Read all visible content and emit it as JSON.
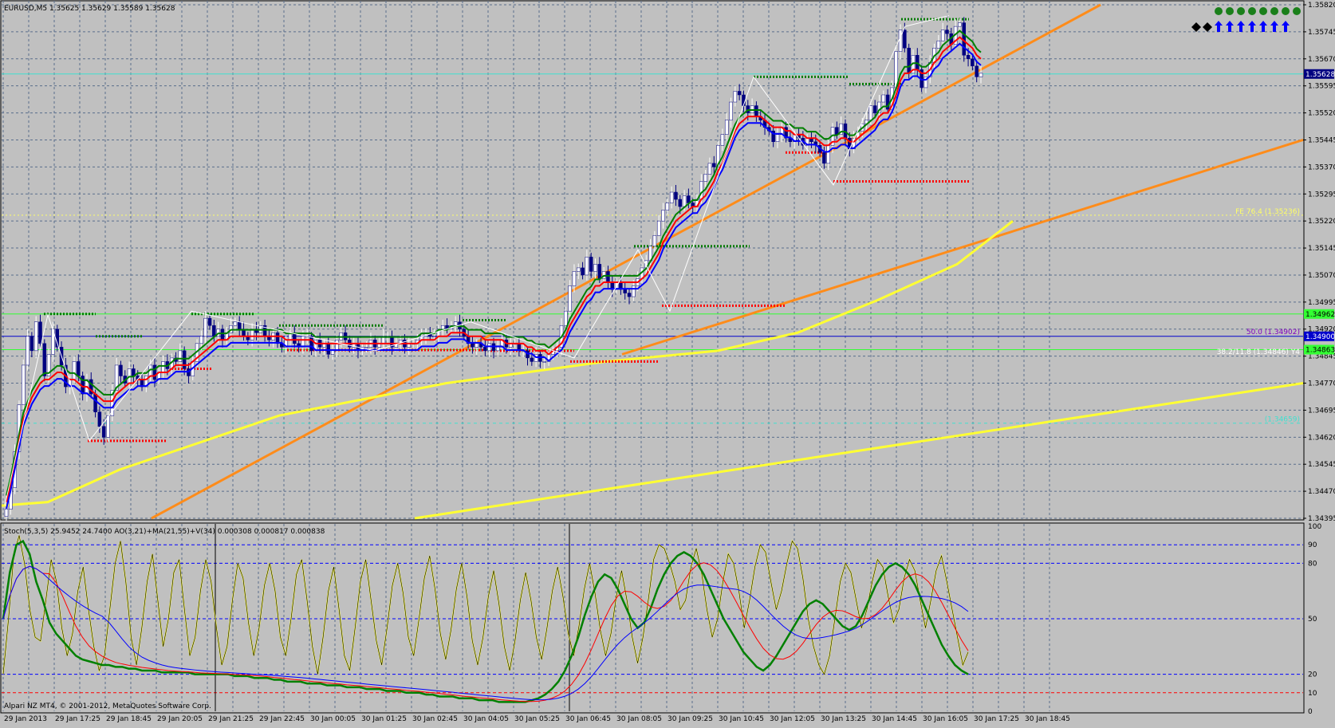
{
  "window": {
    "symbol_header": "EURUSD,M5  1.35625 1.35629 1.35589 1.35628",
    "indicator_header": "Stoch(5,3,5) 25.9452 24.7400  AO(3,21)+MA(21,55)+V(34) 0.000308 0.000817 0.000838",
    "copyright": "Alpari NZ MT4, © 2001-2012, MetaQuotes Software Corp."
  },
  "colors": {
    "background": "#c0c0c0",
    "grid": "#5a6e8c",
    "bull_candle": "#ffffff",
    "bear_candle": "#000080",
    "ma_green": "#008000",
    "ma_red": "#ff0000",
    "ma_blue": "#0000ff",
    "trend_orange": "#ff8c1a",
    "trend_yellow": "#ffff33",
    "level_cyan": "#40e0d0",
    "level_green": "#33ff33",
    "level_blue": "#0000cc",
    "current_price_box": "#000080",
    "zigzag": "#ffffff",
    "resistance_dots": "#007a00",
    "support_dots": "#ff0000",
    "stoch_main": "#ffff33",
    "stoch_green": "#008000",
    "stoch_red": "#ff0000",
    "stoch_blue": "#0000ff"
  },
  "signals": {
    "top_row_icon": "green-dot-icon",
    "top_row_count": 8,
    "arrow_icon": "blue-up-arrow-icon",
    "arrow_count": 7,
    "diamond_icon": "black-diamond-icon",
    "diamond_count": 2
  },
  "chart_data": [
    {
      "type": "candlestick",
      "symbol": "EURUSD",
      "timeframe": "M5",
      "ylim": [
        1.34395,
        1.3582
      ],
      "price_ticks": [
        "1.35820",
        "1.35745",
        "1.35670",
        "1.35595",
        "1.35520",
        "1.35445",
        "1.35370",
        "1.35295",
        "1.35220",
        "1.35145",
        "1.35070",
        "1.34995",
        "1.34920",
        "1.34845",
        "1.34770",
        "1.34695",
        "1.34620",
        "1.34545",
        "1.34470",
        "1.34395"
      ],
      "time_ticks": [
        "29 Jan 2013",
        "29 Jan 17:25",
        "29 Jan 18:45",
        "29 Jan 20:05",
        "29 Jan 21:25",
        "29 Jan 22:45",
        "30 Jan 00:05",
        "30 Jan 01:25",
        "30 Jan 02:45",
        "30 Jan 04:05",
        "30 Jan 05:25",
        "30 Jan 06:45",
        "30 Jan 08:05",
        "30 Jan 09:25",
        "30 Jan 10:45",
        "30 Jan 12:05",
        "30 Jan 13:25",
        "30 Jan 14:45",
        "30 Jan 16:05",
        "30 Jan 17:25",
        "30 Jan 18:45"
      ],
      "current_price": "1.35628",
      "price_level_boxes": [
        {
          "label": "1.34962",
          "value": 1.34962,
          "color": "#33ff33"
        },
        {
          "label": "1.34900",
          "value": 1.349,
          "color": "#0000cc"
        },
        {
          "label": "1.34863",
          "value": 1.34863,
          "color": "#33ff33"
        }
      ],
      "fib_annotations": [
        {
          "label": "FE 76.4 (1.35236)",
          "value": 1.35236
        },
        {
          "label": "50.0 (1.34902)",
          "value": 1.34902
        },
        {
          "label": "38.2/11.8 (1.34846) Y4",
          "value": 1.34846
        },
        {
          "label": "(1.34659)",
          "value": 1.34659
        }
      ],
      "closes": [
        1.3442,
        1.3448,
        1.3458,
        1.3471,
        1.3482,
        1.349,
        1.3486,
        1.3494,
        1.3488,
        1.3479,
        1.3485,
        1.3492,
        1.3487,
        1.3482,
        1.3476,
        1.3478,
        1.3483,
        1.3479,
        1.3474,
        1.3478,
        1.3474,
        1.3469,
        1.3465,
        1.3462,
        1.3468,
        1.3475,
        1.3482,
        1.3479,
        1.3477,
        1.3481,
        1.3479,
        1.3478,
        1.3476,
        1.3479,
        1.3482,
        1.3478,
        1.348,
        1.3483,
        1.3481,
        1.3484,
        1.3483,
        1.3486,
        1.3481,
        1.3479,
        1.3483,
        1.3488,
        1.349,
        1.3495,
        1.3493,
        1.349,
        1.3492,
        1.3489,
        1.3491,
        1.3493,
        1.3494,
        1.3492,
        1.349,
        1.3489,
        1.3492,
        1.3491,
        1.3493,
        1.349,
        1.3489,
        1.3491,
        1.3488,
        1.3487,
        1.3489,
        1.3491,
        1.3488,
        1.3487,
        1.349,
        1.349,
        1.3486,
        1.3489,
        1.3487,
        1.3488,
        1.3485,
        1.3486,
        1.3489,
        1.3491,
        1.3489,
        1.3487,
        1.3488,
        1.3486,
        1.3487,
        1.3487,
        1.3489,
        1.3487,
        1.3488,
        1.349,
        1.349,
        1.3487,
        1.3488,
        1.3489,
        1.3487,
        1.3488,
        1.3488,
        1.3489,
        1.349,
        1.3491,
        1.349,
        1.349,
        1.3492,
        1.3493,
        1.3492,
        1.3493,
        1.3494,
        1.3492,
        1.349,
        1.3488,
        1.3487,
        1.3488,
        1.3487,
        1.3486,
        1.3488,
        1.3486,
        1.3487,
        1.3489,
        1.3487,
        1.3488,
        1.3488,
        1.3486,
        1.3486,
        1.3484,
        1.3483,
        1.3485,
        1.3483,
        1.3483,
        1.3485,
        1.3486,
        1.3487,
        1.3493,
        1.3497,
        1.3504,
        1.3508,
        1.3509,
        1.3507,
        1.3512,
        1.3508,
        1.351,
        1.3506,
        1.3508,
        1.3505,
        1.3503,
        1.3505,
        1.3503,
        1.3502,
        1.3501,
        1.3504,
        1.3506,
        1.3509,
        1.3511,
        1.3515,
        1.3518,
        1.3522,
        1.3525,
        1.3527,
        1.353,
        1.3528,
        1.3526,
        1.3529,
        1.3527,
        1.3526,
        1.3528,
        1.3533,
        1.3535,
        1.3538,
        1.3537,
        1.3543,
        1.3546,
        1.355,
        1.3555,
        1.3558,
        1.3557,
        1.3554,
        1.3552,
        1.3554,
        1.3551,
        1.355,
        1.3548,
        1.3547,
        1.3544,
        1.3546,
        1.3548,
        1.3545,
        1.3544,
        1.3546,
        1.3545,
        1.3543,
        1.3545,
        1.3544,
        1.3543,
        1.3541,
        1.3538,
        1.3543,
        1.3548,
        1.3546,
        1.3549,
        1.3545,
        1.3542,
        1.3545,
        1.3547,
        1.3549,
        1.355,
        1.3554,
        1.3552,
        1.3555,
        1.3557,
        1.3553,
        1.3559,
        1.3569,
        1.3575,
        1.357,
        1.3563,
        1.3568,
        1.3564,
        1.3559,
        1.3562,
        1.3566,
        1.357,
        1.3572,
        1.3575,
        1.3574,
        1.3571,
        1.3576,
        1.3577,
        1.3568,
        1.3567,
        1.3565,
        1.3562,
        1.3563
      ],
      "ma_red": [
        1.3444,
        1.3449,
        1.3455,
        1.3461,
        1.3467,
        1.347,
        1.3473,
        1.3475,
        1.3477,
        1.3478,
        1.3478,
        1.3479,
        1.348,
        1.348,
        1.3479,
        1.3478,
        1.3478,
        1.3477,
        1.3476,
        1.3476,
        1.3475,
        1.3474,
        1.3473,
        1.3472,
        1.3472,
        1.3472,
        1.3474,
        1.3475,
        1.3476,
        1.3477,
        1.3477,
        1.3478,
        1.3478,
        1.3478,
        1.3479,
        1.3479,
        1.348,
        1.348,
        1.348,
        1.3481,
        1.3482,
        1.3482,
        1.3482,
        1.3482,
        1.3483,
        1.3484,
        1.3485,
        1.3486,
        1.3487,
        1.3488,
        1.3489,
        1.3489,
        1.3489,
        1.349,
        1.349,
        1.349,
        1.349,
        1.349,
        1.349,
        1.349,
        1.349,
        1.349,
        1.349,
        1.349,
        1.349,
        1.349,
        1.3489,
        1.3489,
        1.3489,
        1.3489,
        1.3489,
        1.3489,
        1.3489,
        1.3488,
        1.3488,
        1.3488,
        1.3488,
        1.3488,
        1.3488,
        1.3488,
        1.3488,
        1.3488,
        1.3488,
        1.3488,
        1.3488,
        1.3488,
        1.3488,
        1.3488,
        1.3488,
        1.3488,
        1.3488,
        1.3488,
        1.3488,
        1.3488,
        1.3488,
        1.3488,
        1.3488,
        1.3488,
        1.3489,
        1.3489,
        1.3489,
        1.3489,
        1.349,
        1.349,
        1.349,
        1.3491,
        1.3491,
        1.3491,
        1.3491,
        1.349,
        1.349,
        1.349,
        1.349,
        1.3489,
        1.3489,
        1.3489,
        1.3489,
        1.3489,
        1.3488,
        1.3488,
        1.3488,
        1.3488,
        1.3488,
        1.3487,
        1.3487,
        1.3486,
        1.3486,
        1.3486,
        1.3485,
        1.3486,
        1.3487,
        1.3488,
        1.349,
        1.3493,
        1.3495,
        1.3497,
        1.3499,
        1.3501,
        1.3502,
        1.3504,
        1.3504,
        1.3505,
        1.3505,
        1.3505,
        1.3505,
        1.3505,
        1.3505,
        1.3505,
        1.3505,
        1.3505,
        1.3506,
        1.3507,
        1.3509,
        1.3511,
        1.3513,
        1.3516,
        1.3518,
        1.352,
        1.3522,
        1.3523,
        1.3524,
        1.3525,
        1.3526,
        1.3526,
        1.3528,
        1.3529,
        1.3531,
        1.3533,
        1.3536,
        1.3538,
        1.3541,
        1.3544,
        1.3547,
        1.3549,
        1.355,
        1.3551,
        1.3551,
        1.3551,
        1.3551,
        1.355,
        1.3549,
        1.3548,
        1.3548,
        1.3548,
        1.3547,
        1.3547,
        1.3546,
        1.3546,
        1.3546,
        1.3545,
        1.3545,
        1.3545,
        1.3544,
        1.3543,
        1.3543,
        1.3544,
        1.3544,
        1.3545,
        1.3545,
        1.3544,
        1.3544,
        1.3545,
        1.3546,
        1.3547,
        1.3548,
        1.3549,
        1.3551,
        1.3552,
        1.3552,
        1.3554,
        1.3557,
        1.3561,
        1.3563,
        1.3563,
        1.3564,
        1.3564,
        1.3563,
        1.3563,
        1.3564,
        1.3566,
        1.3567,
        1.3569,
        1.357,
        1.3571,
        1.3572,
        1.3573,
        1.3572,
        1.3571,
        1.357,
        1.3568,
        1.3567
      ],
      "stoch_main": [
        20,
        50,
        85,
        95,
        80,
        55,
        40,
        38,
        60,
        82,
        70,
        45,
        30,
        42,
        65,
        78,
        55,
        35,
        22,
        30,
        55,
        80,
        92,
        70,
        40,
        25,
        45,
        70,
        85,
        60,
        35,
        50,
        75,
        82,
        55,
        30,
        40,
        65,
        82,
        70,
        45,
        25,
        35,
        60,
        80,
        72,
        48,
        30,
        45,
        68,
        80,
        65,
        40,
        30,
        50,
        74,
        82,
        60,
        35,
        20,
        40,
        65,
        78,
        55,
        30,
        22,
        45,
        70,
        82,
        60,
        38,
        25,
        45,
        68,
        80,
        64,
        40,
        30,
        50,
        72,
        84,
        66,
        42,
        28,
        44,
        66,
        80,
        62,
        38,
        25,
        40,
        62,
        76,
        58,
        35,
        22,
        38,
        60,
        75,
        60,
        40,
        28,
        45,
        65,
        78,
        62,
        42,
        30,
        46,
        66,
        80,
        64,
        44,
        30,
        42,
        62,
        76,
        60,
        40,
        26,
        40,
        60,
        82,
        90,
        88,
        80,
        70,
        55,
        60,
        78,
        88,
        75,
        55,
        40,
        50,
        70,
        85,
        80,
        65,
        45,
        60,
        78,
        90,
        86,
        70,
        55,
        65,
        80,
        92,
        88,
        72,
        50,
        35,
        25,
        20,
        30,
        50,
        70,
        80,
        75,
        60,
        45,
        55,
        70,
        82,
        78,
        62,
        48,
        55,
        72,
        82,
        76,
        60,
        45,
        60,
        76,
        84,
        70,
        55,
        40,
        25,
        32
      ],
      "stoch_green": [
        50,
        75,
        90,
        92,
        85,
        70,
        60,
        48,
        42,
        38,
        34,
        30,
        28,
        27,
        26,
        25,
        25,
        24,
        24,
        23,
        23,
        22,
        22,
        22,
        21,
        21,
        21,
        21,
        21,
        20,
        20,
        20,
        20,
        20,
        20,
        19,
        19,
        19,
        18,
        18,
        18,
        17,
        17,
        16,
        16,
        16,
        15,
        15,
        15,
        14,
        14,
        14,
        13,
        13,
        13,
        12,
        12,
        12,
        11,
        11,
        11,
        10,
        10,
        10,
        9,
        9,
        8,
        8,
        8,
        7,
        7,
        7,
        6,
        6,
        6,
        5,
        5,
        5,
        5,
        5,
        6,
        7,
        9,
        12,
        16,
        22,
        30,
        40,
        52,
        62,
        70,
        74,
        72,
        66,
        58,
        50,
        45,
        48,
        56,
        66,
        74,
        80,
        84,
        86,
        84,
        80,
        74,
        66,
        58,
        50,
        44,
        38,
        32,
        28,
        24,
        22,
        25,
        30,
        36,
        42,
        48,
        54,
        58,
        60,
        58,
        54,
        50,
        46,
        44,
        46,
        52,
        60,
        68,
        74,
        78,
        80,
        78,
        74,
        68,
        60,
        52,
        44,
        36,
        30,
        25,
        22,
        20
      ]
    },
    {
      "type": "line",
      "name": "Stoch(5,3,5)",
      "ylim": [
        0,
        100
      ],
      "y_ticks": [
        "100",
        "90",
        "80",
        "50",
        "20",
        "10",
        "0"
      ]
    }
  ]
}
